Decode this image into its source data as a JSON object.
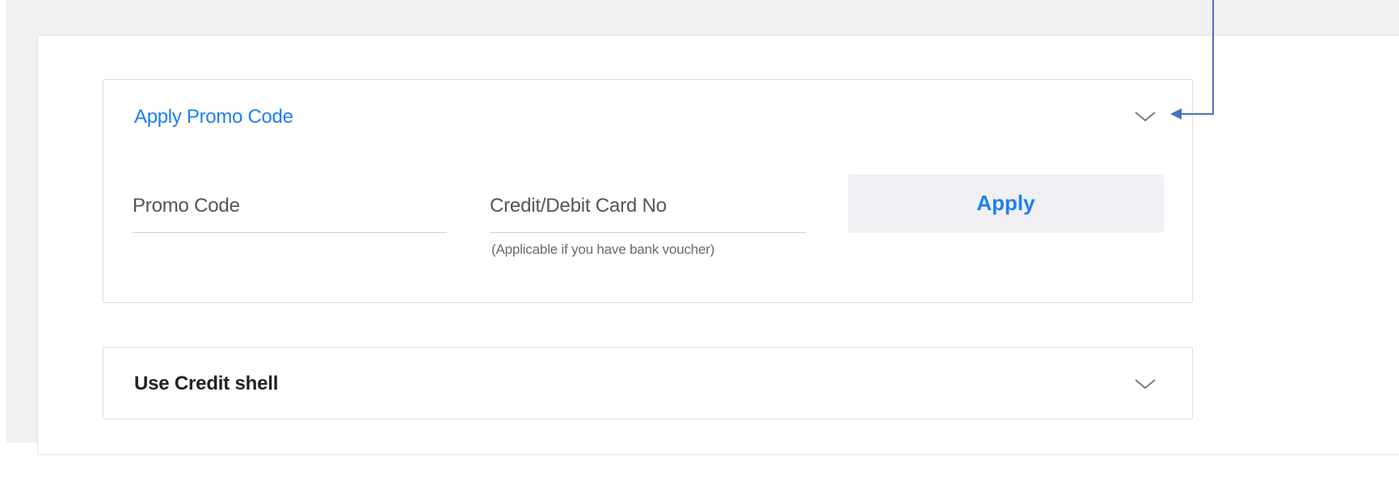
{
  "promo_panel": {
    "title": "Apply Promo Code",
    "promo_code_placeholder": "Promo Code",
    "card_number_placeholder": "Credit/Debit Card No",
    "card_hint": "(Applicable if you have bank voucher)",
    "apply_label": "Apply",
    "toggle_icon": "chevron-down-icon"
  },
  "credit_shell_panel": {
    "title": "Use Credit shell",
    "toggle_icon": "chevron-down-icon"
  },
  "colors": {
    "accent": "#1e7ff2",
    "page_background": "#f1f1f4",
    "button_background": "#f0f0f5",
    "annotation_arrow": "#4a72c4"
  }
}
